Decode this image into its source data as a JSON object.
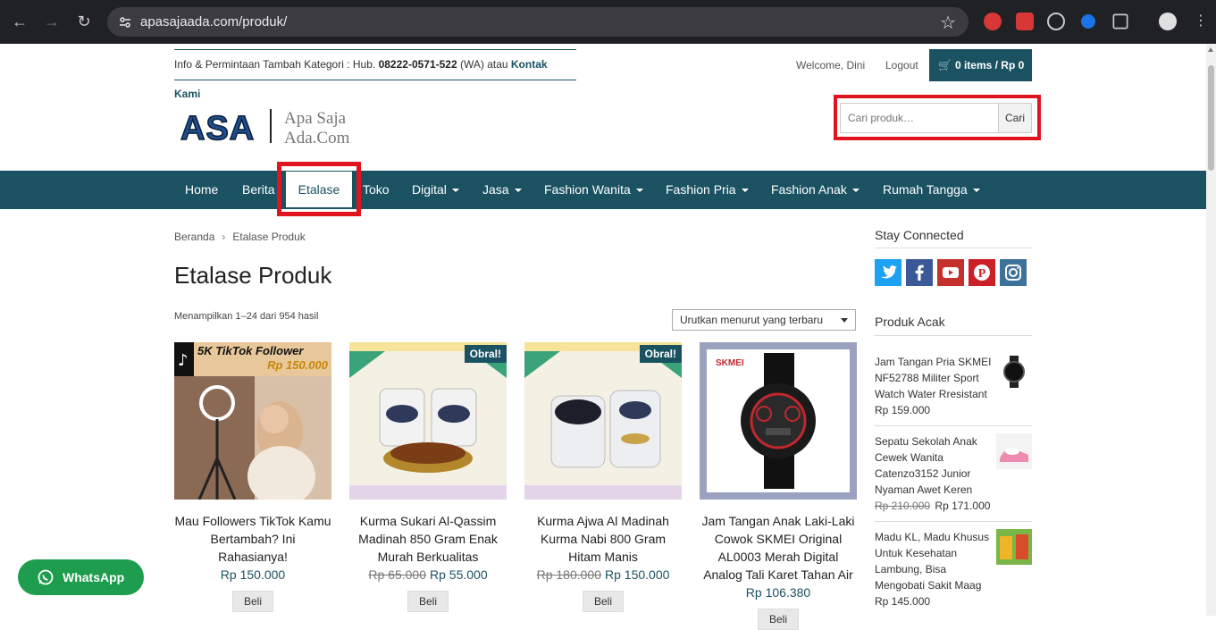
{
  "browser": {
    "url": "apasajaada.com/produk/",
    "colors": {
      "frame": "#202124",
      "urlbar": "#3c3c3f"
    }
  },
  "topbar": {
    "info_prefix": "Info & Permintaan Tambah Kategori : Hub. ",
    "phone": "08222-0571-522",
    "info_middle": " (WA) atau ",
    "contact_link": "Kontak Kami",
    "welcome": "Welcome, Dini",
    "logout": "Logout",
    "cart": "0 items / Rp 0"
  },
  "logo": {
    "mark": "ASA",
    "tagline_1": "Apa Saja",
    "tagline_2": "Ada.Com"
  },
  "search": {
    "placeholder": "Cari produk…",
    "button": "Cari"
  },
  "nav": {
    "items": [
      {
        "label": "Home"
      },
      {
        "label": "Berita"
      },
      {
        "label": "Etalase"
      },
      {
        "label": "Toko"
      },
      {
        "label": "Digital"
      },
      {
        "label": "Jasa"
      },
      {
        "label": "Fashion Wanita"
      },
      {
        "label": "Fashion Pria"
      },
      {
        "label": "Fashion Anak"
      },
      {
        "label": "Rumah Tangga"
      }
    ]
  },
  "breadcrumb": {
    "home": "Beranda",
    "current": "Etalase Produk"
  },
  "main": {
    "title": "Etalase Produk",
    "result_count": "Menampilkan 1–24 dari 954 hasil",
    "sort_selected": "Urutkan menurut yang terbaru"
  },
  "products": [
    {
      "title": "Mau Followers TikTok Kamu Bertambah? Ini Rahasianya!",
      "old_price": "",
      "price": "Rp 150.000",
      "badge": "",
      "button": "Beli",
      "img_text_1": "5K TikTok Follower",
      "img_text_2": "Rp 150.000"
    },
    {
      "title": "Kurma Sukari Al-Qassim Madinah 850 Gram Enak Murah Berkualitas",
      "old_price": "Rp 65.000",
      "price": "Rp 55.000",
      "badge": "Obral!",
      "button": "Beli"
    },
    {
      "title": "Kurma Ajwa Al Madinah Kurma Nabi 800 Gram Hitam Manis",
      "old_price": "Rp 180.000",
      "price": "Rp 150.000",
      "badge": "Obral!",
      "button": "Beli"
    },
    {
      "title": "Jam Tangan Anak Laki-Laki Cowok SKMEI Original AL0003 Merah Digital Analog Tali Karet Tahan Air",
      "old_price": "",
      "price": "Rp 106.380",
      "badge": "",
      "button": "Beli",
      "img_brand": "SKMEI"
    }
  ],
  "sidebar": {
    "stay_connected": "Stay Connected",
    "random_title": "Produk Acak",
    "social": [
      "twitter-icon",
      "facebook-icon",
      "youtube-icon",
      "pinterest-icon",
      "instagram-icon"
    ],
    "random_products": [
      {
        "name": "Jam Tangan Pria SKMEI NF52788 Militer Sport Watch Water Rresistant",
        "old_price": "",
        "price": "Rp 159.000"
      },
      {
        "name": "Sepatu Sekolah Anak Cewek Wanita Catenzo3152 Junior Nyaman Awet Keren",
        "old_price": "Rp 210.000",
        "price": "Rp 171.000"
      },
      {
        "name": "Madu KL, Madu Khusus Untuk Kesehatan Lambung, Bisa Mengobati Sakit Maag",
        "old_price": "",
        "price": "Rp 145.000"
      }
    ]
  },
  "whatsapp": {
    "label": "WhatsApp"
  },
  "theme": {
    "primary": "#1a5262",
    "highlight": "#e0141e",
    "whatsapp": "#1f9d4e"
  }
}
